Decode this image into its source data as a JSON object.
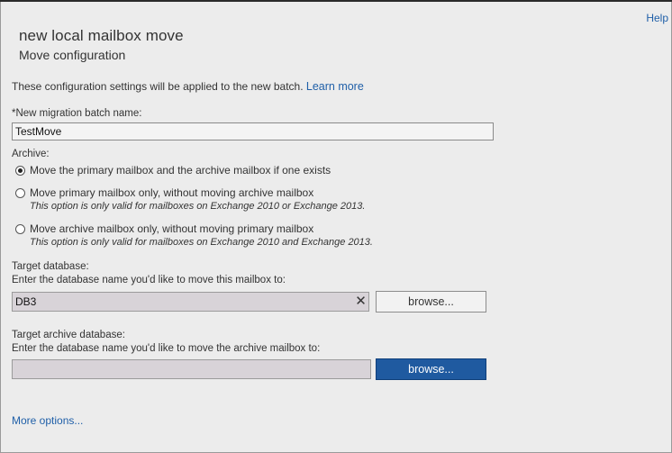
{
  "header": {
    "help_label": "Help",
    "title": "new local mailbox move",
    "subtitle": "Move configuration"
  },
  "intro": {
    "text": "These configuration settings will be applied to the new batch.",
    "link": "Learn more"
  },
  "batch_name": {
    "label": "*New migration batch name:",
    "value": "TestMove"
  },
  "archive": {
    "label": "Archive:",
    "options": [
      {
        "label": "Move the primary mailbox and the archive mailbox if one exists",
        "note": "",
        "checked": true
      },
      {
        "label": "Move primary mailbox only, without moving archive mailbox",
        "note": "This option is only valid for mailboxes on Exchange 2010 or Exchange 2013.",
        "checked": false
      },
      {
        "label": "Move archive mailbox only, without moving primary mailbox",
        "note": "This option is only valid for mailboxes on Exchange 2010 and Exchange 2013.",
        "checked": false
      }
    ]
  },
  "target_db": {
    "label": "Target database:",
    "instruction": "Enter the database name you'd like to move this mailbox to:",
    "value": "DB3",
    "clear_glyph": "✕",
    "browse_label": "browse..."
  },
  "target_archive_db": {
    "label": "Target archive database:",
    "instruction": "Enter the database name you'd like to move the archive mailbox to:",
    "value": "",
    "browse_label": "browse..."
  },
  "more_options_label": "More options...",
  "colors": {
    "link": "#1f5fa8",
    "primary_button": "#1f5aa0",
    "field_fill": "#d8d3d8",
    "background": "#ececec"
  }
}
